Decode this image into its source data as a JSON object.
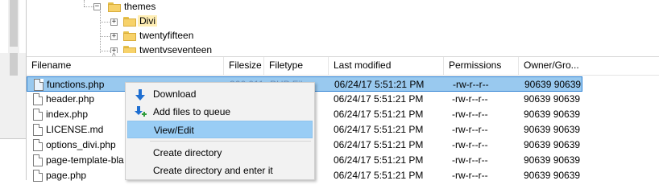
{
  "tree": {
    "nodes": [
      {
        "label": "themes",
        "expander": "−"
      },
      {
        "label": "Divi",
        "expander": "+"
      },
      {
        "label": "twentyfifteen",
        "expander": "+"
      },
      {
        "label": "twentyseventeen",
        "expander": "+"
      }
    ]
  },
  "file_list": {
    "columns": [
      "Filename",
      "Filesize",
      "Filetype",
      "Last modified",
      "Permissions",
      "Owner/Gro..."
    ],
    "sort_indicator": "^",
    "rows": [
      {
        "name": "functions.php",
        "size": "366,011",
        "type": "PHP File",
        "modified": "06/24/17 5:51:21 PM",
        "permissions": "-rw-r--r--",
        "owner": "90639 90639",
        "selected": true
      },
      {
        "name": "header.php",
        "size": "",
        "type": "",
        "modified": "06/24/17 5:51:21 PM",
        "permissions": "-rw-r--r--",
        "owner": "90639 90639"
      },
      {
        "name": "index.php",
        "size": "",
        "type": "",
        "modified": "06/24/17 5:51:21 PM",
        "permissions": "-rw-r--r--",
        "owner": "90639 90639"
      },
      {
        "name": "LICENSE.md",
        "size": "",
        "type": "",
        "modified": "06/24/17 5:51:21 PM",
        "permissions": "-rw-r--r--",
        "owner": "90639 90639"
      },
      {
        "name": "options_divi.php",
        "size": "",
        "type": "",
        "modified": "06/24/17 5:51:21 PM",
        "permissions": "-rw-r--r--",
        "owner": "90639 90639"
      },
      {
        "name": "page-template-bla",
        "size": "",
        "type": "",
        "modified": "06/24/17 5:51:21 PM",
        "permissions": "-rw-r--r--",
        "owner": "90639 90639"
      },
      {
        "name": "page.php",
        "size": "",
        "type": "",
        "modified": "06/24/17 5:51:21 PM",
        "permissions": "-rw-r--r--",
        "owner": "90639 90639"
      }
    ]
  },
  "context_menu": {
    "items": [
      {
        "label": "Download",
        "icon": "download-arrow-icon"
      },
      {
        "label": "Add files to queue",
        "icon": "add-to-queue-icon"
      },
      {
        "label": "View/Edit",
        "icon": "",
        "highlighted": true
      },
      {
        "label": "Create directory",
        "icon": ""
      },
      {
        "label": "Create directory and enter it",
        "icon": ""
      }
    ]
  },
  "colors": {
    "selection_bg": "#99c9ef",
    "menu_highlight": "#99cdf5",
    "folder": "#f7d26a"
  }
}
